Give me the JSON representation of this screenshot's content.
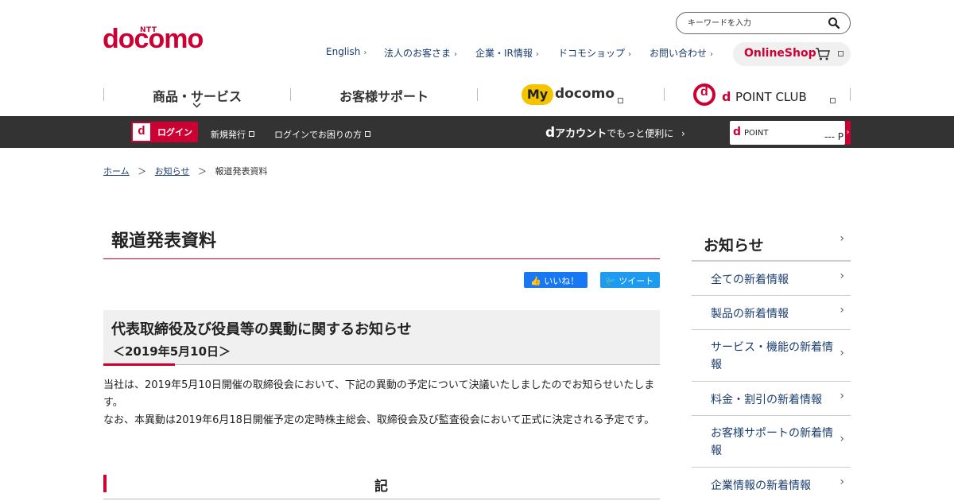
{
  "header": {
    "logo_ntt": "NTT",
    "logo": "docomo",
    "search_placeholder": "キーワードを入力",
    "links": [
      "English",
      "法人のお客さま",
      "企業・IR情報",
      "ドコモショップ",
      "お問い合わせ"
    ],
    "online_shop": "OnlineShop"
  },
  "nav": {
    "products": "商品・サービス",
    "support": "お客様サポート",
    "mydocomo_my": "My",
    "mydocomo": "docomo",
    "dpoint_d": "d",
    "dpoint_point": "POINT CLUB"
  },
  "accountbar": {
    "login": "ログイン",
    "register": "新規発行",
    "trouble": "ログインでお困りの方",
    "daccount_prefix": "d",
    "daccount_strong": "アカウント",
    "daccount_rest": "でもっと便利に",
    "dpoint_label": "POINT",
    "dpoint_value": "--- P"
  },
  "breadcrumb": {
    "home": "ホーム",
    "news": "お知らせ",
    "current": "報道発表資料"
  },
  "main": {
    "title": "報道発表資料",
    "like": "いいね！",
    "tweet": "ツイート",
    "news_title": "代表取締役及び役員等の異動に関するお知らせ",
    "news_date": "＜2019年5月10日＞",
    "body_1": "当社は、2019年5月10日開催の取締役会において、下記の異動の予定について決議いたしましたのでお知らせいたします。",
    "body_2": "なお、本異動は2019年6月18日開催予定の定時株主総会、取締役会及び監査役会において正式に決定される予定です。",
    "ki": "記"
  },
  "sidebar": {
    "heading": "お知らせ",
    "items": [
      "全ての新着情報",
      "製品の新着情報",
      "サービス・機能の新着情報",
      "料金・割引の新着情報",
      "お客様サポートの新着情報",
      "企業情報の新着情報"
    ]
  },
  "colors": {
    "brand": "#cc0033",
    "link": "#1a3d6e",
    "bar": "#333333"
  }
}
